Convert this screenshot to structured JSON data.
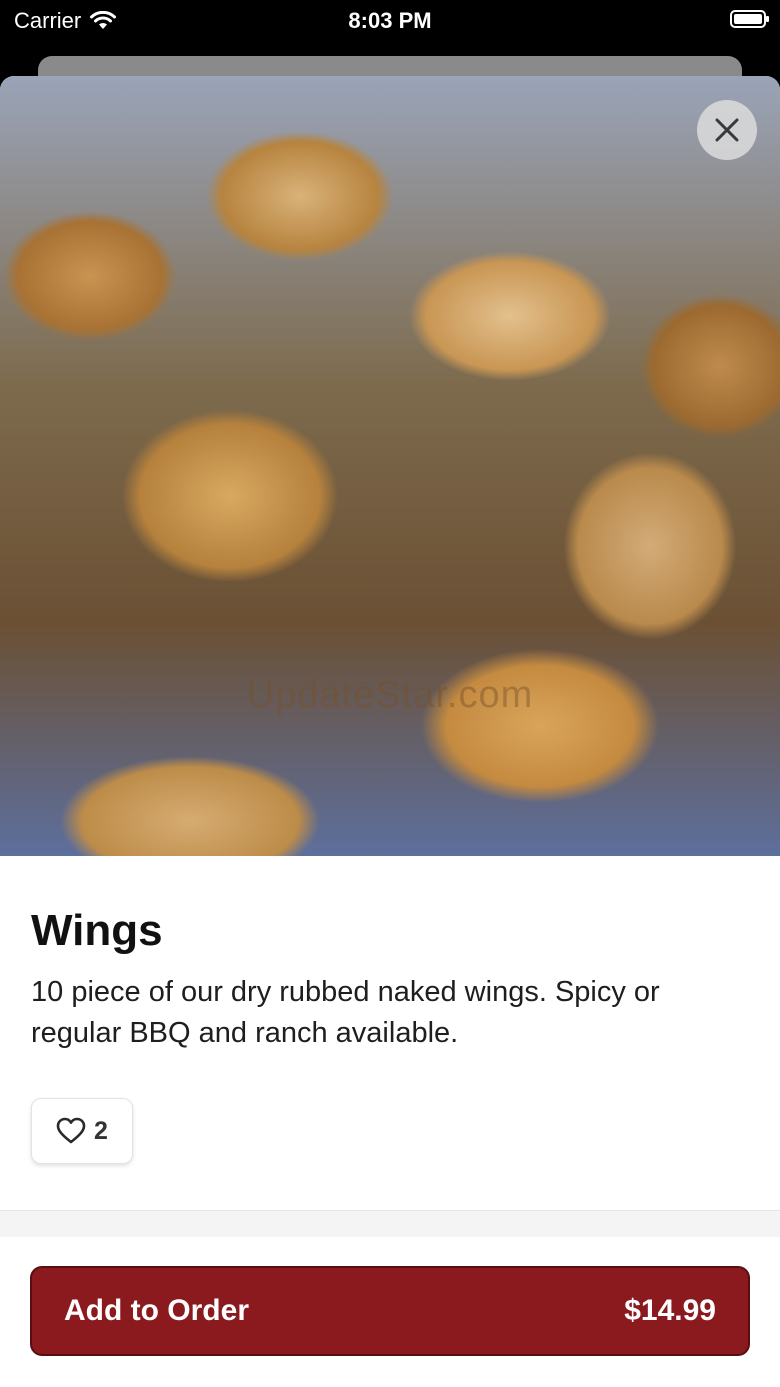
{
  "status_bar": {
    "carrier": "Carrier",
    "time": "8:03 PM"
  },
  "item": {
    "image_icon": "chicken-wings-photo",
    "watermark": "UpdateStar.com",
    "title": "Wings",
    "description": "10 piece of our dry rubbed naked wings. Spicy or regular BBQ and ranch available.",
    "likes": "2"
  },
  "actions": {
    "close_icon": "close-icon",
    "like_icon": "heart-icon",
    "add_label": "Add to Order",
    "price": "$14.99"
  },
  "colors": {
    "accent": "#8b1a1f",
    "accent_border": "#5a0e12"
  }
}
